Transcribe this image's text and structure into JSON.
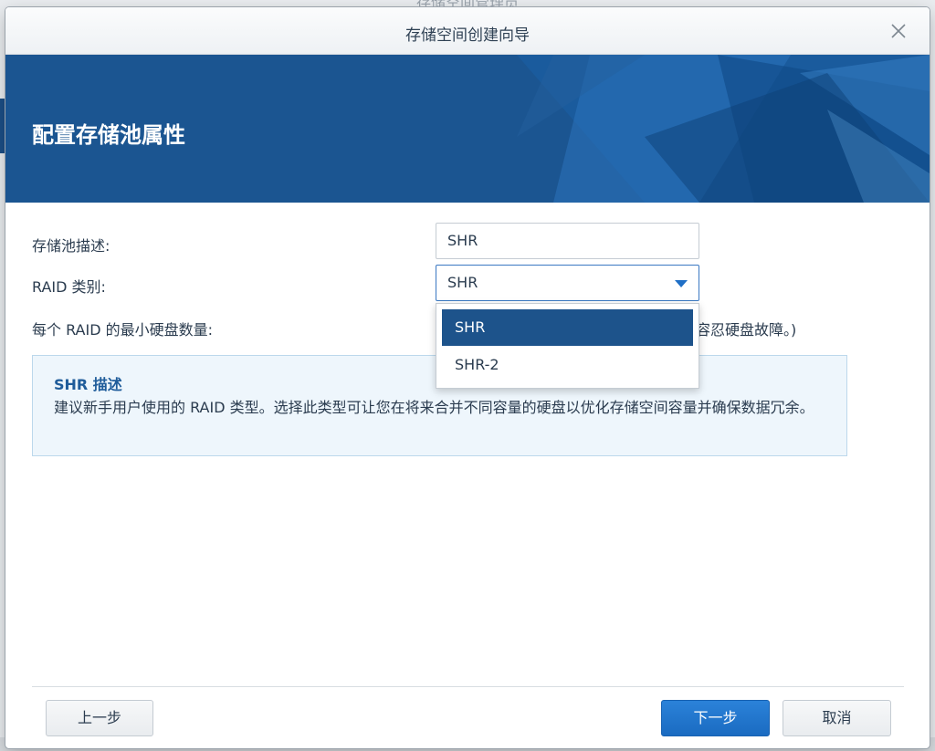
{
  "background": {
    "window_title": "存储空间管理员"
  },
  "dialog": {
    "title": "存储空间创建向导",
    "close_icon": "close-icon",
    "banner_heading": "配置存储池属性"
  },
  "form": {
    "description_label": "存储池描述:",
    "description_value": "SHR",
    "raid_label": "RAID 类别:",
    "raid_selected": "SHR",
    "raid_options": [
      "SHR",
      "SHR-2"
    ],
    "min_disks_label": "每个 RAID 的最小硬盘数量:",
    "min_disks_hint_tail": "去容忍硬盘故障。)"
  },
  "info_box": {
    "title": "SHR 描述",
    "text": "建议新手用户使用的 RAID 类型。选择此类型可让您在将来合并不同容量的硬盘以优化存储空间容量并确保数据冗余。"
  },
  "footer": {
    "prev_label": "上一步",
    "next_label": "下一步",
    "cancel_label": "取消"
  },
  "colors": {
    "accent": "#1b5591",
    "selected_option": "#1d538b",
    "primary_button": "#1f72c9"
  }
}
